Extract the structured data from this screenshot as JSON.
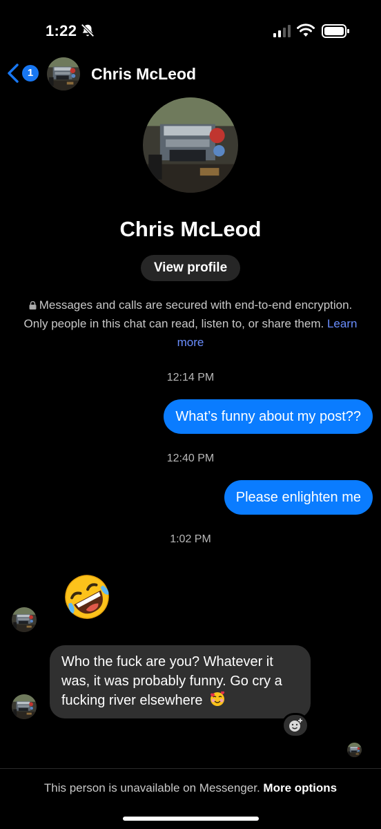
{
  "status_bar": {
    "time": "1:22",
    "icons": [
      "bell-slash-icon",
      "signal-icon",
      "wifi-icon",
      "battery-icon"
    ]
  },
  "header": {
    "back_badge": "1",
    "contact_name": "Chris McLeod"
  },
  "profile": {
    "name": "Chris McLeod",
    "view_profile_label": "View profile",
    "encryption_text": "Messages and calls are secured with end-to-end encryption. Only people in this chat can read, listen to, or share them.",
    "learn_more": "Learn more"
  },
  "messages": [
    {
      "timestamp": "12:14 PM",
      "direction": "outgoing",
      "text": "What’s funny about my post??"
    },
    {
      "timestamp": "12:40 PM",
      "direction": "outgoing",
      "text": "Please enlighten me"
    },
    {
      "timestamp": "1:02 PM",
      "direction": "incoming",
      "emoji": "rolling-on-floor-laughing-emoji"
    },
    {
      "direction": "incoming",
      "text": "Who the fuck are you? Whatever it was, it was probably funny. Go cry a fucking river elsewhere",
      "trailing_emoji": "smiling-face-with-hearts-emoji"
    }
  ],
  "footer": {
    "notice": "This person is unavailable on Messenger.",
    "more_options": "More options"
  },
  "colors": {
    "background": "#000000",
    "outgoing_bubble": "#0a7cff",
    "incoming_bubble": "#303030",
    "link": "#6a8eff"
  }
}
